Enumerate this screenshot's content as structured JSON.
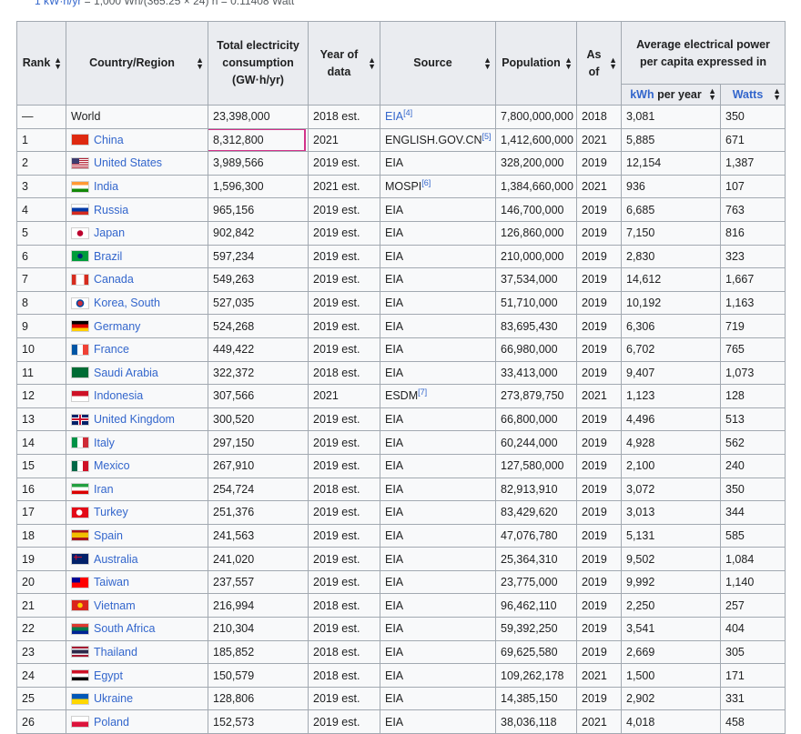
{
  "page": {
    "top_text_prefix": "",
    "top_text_link": "1 kW·h/yr",
    "top_text_rest": " = 1,000 Wh/(365.25 × 24) h = 0.11408 Watt"
  },
  "table": {
    "headers": {
      "rank": "Rank",
      "country": "Country/Region",
      "consumption": "Total electricity consumption (GW·h/yr)",
      "year": "Year of data",
      "source": "Source",
      "population": "Population",
      "as_of": "As of",
      "avg_power": "Average electrical power per capita expressed in",
      "kwh": "kWh",
      "kwh_rest": " per year",
      "watts": "Watts"
    },
    "rows": [
      {
        "rank": "—",
        "country": "World",
        "flag": "none",
        "consumption": "23,398,000",
        "year": "2018 est.",
        "source": "EIA",
        "ref": "[4]",
        "population": "7,800,000,000",
        "as_of": "2018",
        "kwh": "3,081",
        "watts": "350"
      },
      {
        "rank": "1",
        "country": "China",
        "flag": "china",
        "consumption": "8,312,800",
        "year": "2021",
        "source": "ENGLISH.GOV.CN",
        "ref": "[5]",
        "population": "1,412,600,000",
        "as_of": "2021",
        "kwh": "5,885",
        "watts": "671"
      },
      {
        "rank": "2",
        "country": "United States",
        "flag": "usa",
        "consumption": "3,989,566",
        "year": "2019 est.",
        "source": "EIA",
        "ref": "",
        "population": "328,200,000",
        "as_of": "2019",
        "kwh": "12,154",
        "watts": "1,387"
      },
      {
        "rank": "3",
        "country": "India",
        "flag": "india",
        "consumption": "1,596,300",
        "year": "2021 est.",
        "source": "MOSPI",
        "ref": "[6]",
        "population": "1,384,660,000",
        "as_of": "2021",
        "kwh": "936",
        "watts": "107"
      },
      {
        "rank": "4",
        "country": "Russia",
        "flag": "russia",
        "consumption": "965,156",
        "year": "2019 est.",
        "source": "EIA",
        "ref": "",
        "population": "146,700,000",
        "as_of": "2019",
        "kwh": "6,685",
        "watts": "763"
      },
      {
        "rank": "5",
        "country": "Japan",
        "flag": "japan",
        "consumption": "902,842",
        "year": "2019 est.",
        "source": "EIA",
        "ref": "",
        "population": "126,860,000",
        "as_of": "2019",
        "kwh": "7,150",
        "watts": "816"
      },
      {
        "rank": "6",
        "country": "Brazil",
        "flag": "brazil",
        "consumption": "597,234",
        "year": "2019 est.",
        "source": "EIA",
        "ref": "",
        "population": "210,000,000",
        "as_of": "2019",
        "kwh": "2,830",
        "watts": "323"
      },
      {
        "rank": "7",
        "country": "Canada",
        "flag": "canada",
        "consumption": "549,263",
        "year": "2019 est.",
        "source": "EIA",
        "ref": "",
        "population": "37,534,000",
        "as_of": "2019",
        "kwh": "14,612",
        "watts": "1,667"
      },
      {
        "rank": "8",
        "country": "Korea, South",
        "flag": "korea",
        "consumption": "527,035",
        "year": "2019 est.",
        "source": "EIA",
        "ref": "",
        "population": "51,710,000",
        "as_of": "2019",
        "kwh": "10,192",
        "watts": "1,163"
      },
      {
        "rank": "9",
        "country": "Germany",
        "flag": "germany",
        "consumption": "524,268",
        "year": "2019 est.",
        "source": "EIA",
        "ref": "",
        "population": "83,695,430",
        "as_of": "2019",
        "kwh": "6,306",
        "watts": "719"
      },
      {
        "rank": "10",
        "country": "France",
        "flag": "france",
        "consumption": "449,422",
        "year": "2019 est.",
        "source": "EIA",
        "ref": "",
        "population": "66,980,000",
        "as_of": "2019",
        "kwh": "6,702",
        "watts": "765"
      },
      {
        "rank": "11",
        "country": "Saudi Arabia",
        "flag": "saudi",
        "consumption": "322,372",
        "year": "2018 est.",
        "source": "EIA",
        "ref": "",
        "population": "33,413,000",
        "as_of": "2019",
        "kwh": "9,407",
        "watts": "1,073"
      },
      {
        "rank": "12",
        "country": "Indonesia",
        "flag": "indonesia",
        "consumption": "307,566",
        "year": "2021",
        "source": "ESDM",
        "ref": "[7]",
        "population": "273,879,750",
        "as_of": "2021",
        "kwh": "1,123",
        "watts": "128"
      },
      {
        "rank": "13",
        "country": "United Kingdom",
        "flag": "uk",
        "consumption": "300,520",
        "year": "2019 est.",
        "source": "EIA",
        "ref": "",
        "population": "66,800,000",
        "as_of": "2019",
        "kwh": "4,496",
        "watts": "513"
      },
      {
        "rank": "14",
        "country": "Italy",
        "flag": "italy",
        "consumption": "297,150",
        "year": "2019 est.",
        "source": "EIA",
        "ref": "",
        "population": "60,244,000",
        "as_of": "2019",
        "kwh": "4,928",
        "watts": "562"
      },
      {
        "rank": "15",
        "country": "Mexico",
        "flag": "mexico",
        "consumption": "267,910",
        "year": "2019 est.",
        "source": "EIA",
        "ref": "",
        "population": "127,580,000",
        "as_of": "2019",
        "kwh": "2,100",
        "watts": "240"
      },
      {
        "rank": "16",
        "country": "Iran",
        "flag": "iran",
        "consumption": "254,724",
        "year": "2018 est.",
        "source": "EIA",
        "ref": "",
        "population": "82,913,910",
        "as_of": "2019",
        "kwh": "3,072",
        "watts": "350"
      },
      {
        "rank": "17",
        "country": "Turkey",
        "flag": "turkey",
        "consumption": "251,376",
        "year": "2019 est.",
        "source": "EIA",
        "ref": "",
        "population": "83,429,620",
        "as_of": "2019",
        "kwh": "3,013",
        "watts": "344"
      },
      {
        "rank": "18",
        "country": "Spain",
        "flag": "spain",
        "consumption": "241,563",
        "year": "2019 est.",
        "source": "EIA",
        "ref": "",
        "population": "47,076,780",
        "as_of": "2019",
        "kwh": "5,131",
        "watts": "585"
      },
      {
        "rank": "19",
        "country": "Australia",
        "flag": "australia",
        "consumption": "241,020",
        "year": "2019 est.",
        "source": "EIA",
        "ref": "",
        "population": "25,364,310",
        "as_of": "2019",
        "kwh": "9,502",
        "watts": "1,084"
      },
      {
        "rank": "20",
        "country": "Taiwan",
        "flag": "taiwan",
        "consumption": "237,557",
        "year": "2019 est.",
        "source": "EIA",
        "ref": "",
        "population": "23,775,000",
        "as_of": "2019",
        "kwh": "9,992",
        "watts": "1,140"
      },
      {
        "rank": "21",
        "country": "Vietnam",
        "flag": "vietnam",
        "consumption": "216,994",
        "year": "2018 est.",
        "source": "EIA",
        "ref": "",
        "population": "96,462,110",
        "as_of": "2019",
        "kwh": "2,250",
        "watts": "257"
      },
      {
        "rank": "22",
        "country": "South Africa",
        "flag": "southafrica",
        "consumption": "210,304",
        "year": "2019 est.",
        "source": "EIA",
        "ref": "",
        "population": "59,392,250",
        "as_of": "2019",
        "kwh": "3,541",
        "watts": "404"
      },
      {
        "rank": "23",
        "country": "Thailand",
        "flag": "thailand",
        "consumption": "185,852",
        "year": "2018 est.",
        "source": "EIA",
        "ref": "",
        "population": "69,625,580",
        "as_of": "2019",
        "kwh": "2,669",
        "watts": "305"
      },
      {
        "rank": "24",
        "country": "Egypt",
        "flag": "egypt",
        "consumption": "150,579",
        "year": "2018 est.",
        "source": "EIA",
        "ref": "",
        "population": "109,262,178",
        "as_of": "2021",
        "kwh": "1,500",
        "watts": "171"
      },
      {
        "rank": "25",
        "country": "Ukraine",
        "flag": "ukraine",
        "consumption": "128,806",
        "year": "2019 est.",
        "source": "EIA",
        "ref": "",
        "population": "14,385,150",
        "as_of": "2019",
        "kwh": "2,902",
        "watts": "331"
      },
      {
        "rank": "26",
        "country": "Poland",
        "flag": "poland",
        "consumption": "152,573",
        "year": "2019 est.",
        "source": "EIA",
        "ref": "",
        "population": "38,036,118",
        "as_of": "2021",
        "kwh": "4,018",
        "watts": "458"
      }
    ]
  },
  "highlight": {
    "row_index": 1,
    "column": "consumption",
    "color": "#d2328a"
  },
  "colors": {
    "link": "#3366cc",
    "header_bg": "#eaecf0",
    "cell_bg": "#f8f9fa",
    "border": "#a2a9b1"
  }
}
